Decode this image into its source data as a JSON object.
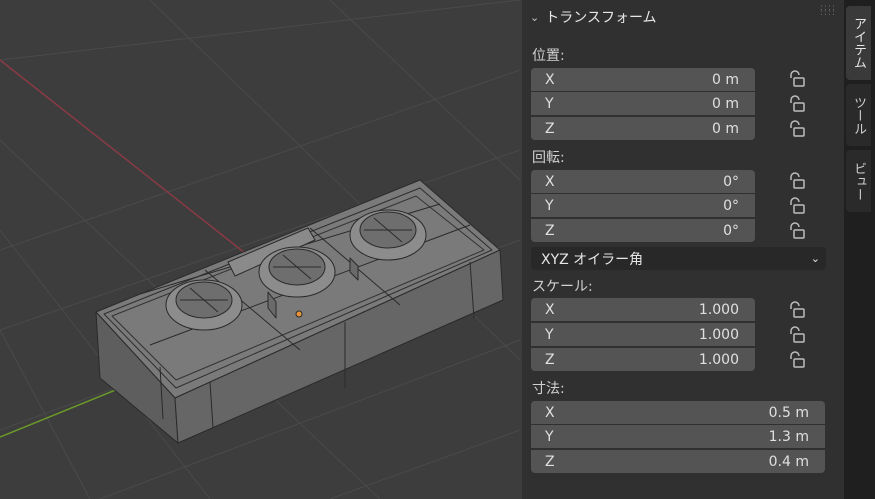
{
  "panel": {
    "header_title": "トランスフォーム",
    "location": {
      "label": "位置:",
      "rows": [
        {
          "axis": "X",
          "value": "0 m"
        },
        {
          "axis": "Y",
          "value": "0 m"
        },
        {
          "axis": "Z",
          "value": "0 m"
        }
      ]
    },
    "rotation": {
      "label": "回転:",
      "rows": [
        {
          "axis": "X",
          "value": "0°"
        },
        {
          "axis": "Y",
          "value": "0°"
        },
        {
          "axis": "Z",
          "value": "0°"
        }
      ],
      "mode": "XYZ オイラー角"
    },
    "scale": {
      "label": "スケール:",
      "rows": [
        {
          "axis": "X",
          "value": "1.000"
        },
        {
          "axis": "Y",
          "value": "1.000"
        },
        {
          "axis": "Z",
          "value": "1.000"
        }
      ]
    },
    "dimensions": {
      "label": "寸法:",
      "rows": [
        {
          "axis": "X",
          "value": "0.5 m"
        },
        {
          "axis": "Y",
          "value": "1.3 m"
        },
        {
          "axis": "Z",
          "value": "0.4 m"
        }
      ]
    }
  },
  "tabs": [
    {
      "label": "アイテム",
      "active": true
    },
    {
      "label": "ツール",
      "active": false
    },
    {
      "label": "ビュー",
      "active": false
    }
  ],
  "colors": {
    "x_axis": "#8a3a44",
    "y_axis": "#6a9a2a",
    "panel_bg": "#303030",
    "field_bg": "#545454",
    "viewport_bg": "#3d3d3d",
    "origin": "#e8943a"
  }
}
